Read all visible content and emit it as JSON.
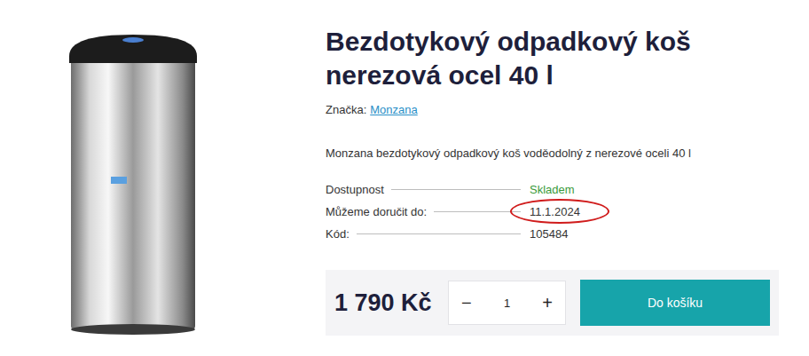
{
  "product": {
    "title": "Bezdotykový odpadkový koš nerezová ocel 40 l",
    "brand_label": "Značka:",
    "brand": "Monzana",
    "description": "Monzana bezdotykový odpadkový koš voděodolný z nerezové oceli 40 l",
    "details": [
      {
        "label": "Dostupnost",
        "value": "Skladem",
        "color": "#3a9a3a",
        "highlighted": false
      },
      {
        "label": "Můžeme doručit do:",
        "value": "11.1.2024",
        "color": "#333333",
        "highlighted": true
      },
      {
        "label": "Kód:",
        "value": "105484",
        "color": "#333333",
        "highlighted": false
      }
    ],
    "price": "1 790 Kč",
    "quantity": {
      "minus": "−",
      "value": "1",
      "plus": "+"
    },
    "add_to_cart": "Do košíku"
  }
}
